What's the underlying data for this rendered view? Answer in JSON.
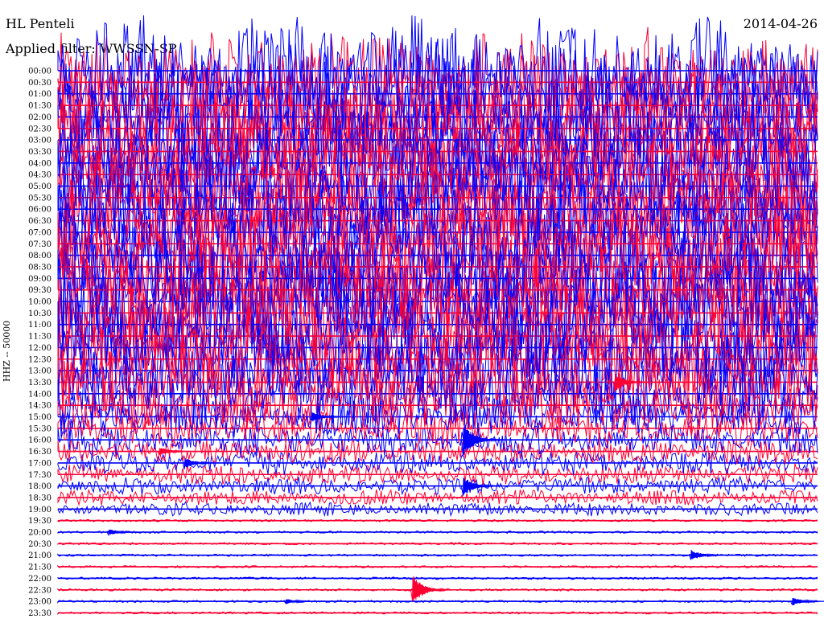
{
  "header": {
    "station": "HL Penteli",
    "date": "2014-04-26",
    "filter": "Applied filter: WWSSN-SP"
  },
  "channel_label": "HHZ -- 50000",
  "colors": {
    "trace_a": "#0000ff",
    "trace_b": "#ff0033",
    "text": "#000000",
    "background": "#ffffff"
  },
  "chart_data": {
    "type": "line",
    "title": "HL Penteli",
    "subtitle": "Applied filter: WWSSN-SP",
    "ylabel": "HHZ -- 50000",
    "row_labels": [
      "00:00",
      "00:30",
      "01:00",
      "01:30",
      "02:00",
      "02:30",
      "03:00",
      "03:30",
      "04:00",
      "04:30",
      "05:00",
      "05:30",
      "06:00",
      "06:30",
      "07:00",
      "07:30",
      "08:00",
      "08:30",
      "09:00",
      "09:30",
      "10:00",
      "10:30",
      "11:00",
      "11:30",
      "12:00",
      "12:30",
      "13:00",
      "13:30",
      "14:00",
      "14:30",
      "15:00",
      "15:30",
      "16:00",
      "16:30",
      "17:00",
      "17:30",
      "18:00",
      "18:30",
      "19:00",
      "19:30",
      "20:00",
      "20:30",
      "21:00",
      "21:30",
      "22:00",
      "22:30",
      "23:00",
      "23:30"
    ],
    "row_colors": [
      "#0000ff",
      "#ff0033"
    ],
    "noise_level": [
      1.0,
      1.0,
      1.0,
      1.0,
      1.0,
      1.0,
      1.0,
      1.0,
      1.0,
      1.0,
      1.0,
      1.0,
      1.0,
      1.0,
      1.0,
      1.0,
      1.0,
      1.0,
      1.0,
      1.0,
      1.0,
      1.0,
      1.0,
      1.0,
      0.9,
      0.85,
      0.8,
      0.75,
      0.7,
      0.55,
      0.35,
      0.3,
      0.25,
      0.2,
      0.18,
      0.15,
      0.12,
      0.1,
      0.08,
      0.06,
      0.04,
      0.03,
      0.03,
      0.03,
      0.03,
      0.03,
      0.03,
      0.03
    ],
    "events": [
      {
        "row": 30,
        "minute": 10,
        "amplitude": 0.5
      },
      {
        "row": 32,
        "minute": 16,
        "amplitude": 1.6
      },
      {
        "row": 33,
        "minute": 4,
        "amplitude": 0.4
      },
      {
        "row": 34,
        "minute": 5,
        "amplitude": 0.5
      },
      {
        "row": 36,
        "minute": 16,
        "amplitude": 0.9
      },
      {
        "row": 27,
        "minute": 22,
        "amplitude": 0.8
      },
      {
        "row": 40,
        "minute": 2,
        "amplitude": 0.3
      },
      {
        "row": 42,
        "minute": 25,
        "amplitude": 0.5
      },
      {
        "row": 45,
        "minute": 14,
        "amplitude": 1.4
      },
      {
        "row": 46,
        "minute": 9,
        "amplitude": 0.25
      },
      {
        "row": 46,
        "minute": 29,
        "amplitude": 0.4
      }
    ]
  }
}
